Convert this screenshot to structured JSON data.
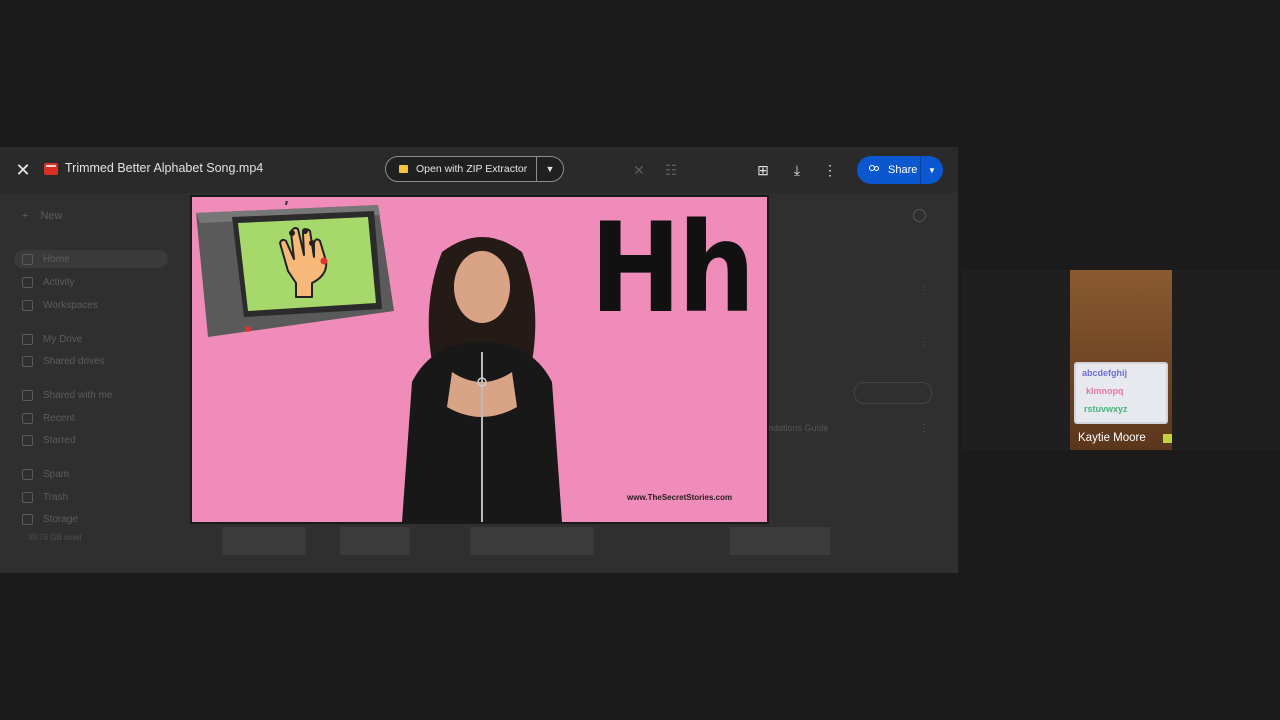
{
  "viewer": {
    "file_title": "Trimmed Better Alphabet Song.mp4",
    "open_with_label": "Open with ZIP Extractor",
    "share_label": "Share"
  },
  "drive_background": {
    "new_label": "New",
    "nav": [
      {
        "label": "Home",
        "icon": "home-icon"
      },
      {
        "label": "Activity",
        "icon": "activity-icon"
      },
      {
        "label": "Workspaces",
        "icon": "workspaces-icon"
      },
      {
        "label": "My Drive",
        "icon": "drive-icon"
      },
      {
        "label": "Shared drives",
        "icon": "shared-drives-icon"
      },
      {
        "label": "Shared with me",
        "icon": "people-icon"
      },
      {
        "label": "Recent",
        "icon": "clock-icon"
      },
      {
        "label": "Starred",
        "icon": "star-icon"
      },
      {
        "label": "Spam",
        "icon": "spam-icon"
      },
      {
        "label": "Trash",
        "icon": "trash-icon"
      },
      {
        "label": "Storage",
        "icon": "cloud-icon"
      }
    ],
    "storage_text": "30.76 GB used",
    "right_item_text": "ndations Guide"
  },
  "video": {
    "letters": "Hh",
    "watermark": "www.TheSecretStories.com"
  },
  "participant": {
    "name": "Kaytie Moore",
    "board_rows": [
      "abcdefghij",
      "klmnopq",
      "rstuvwxyz"
    ]
  },
  "colors": {
    "share_blue": "#0b57d0",
    "video_pink": "#f08cb9",
    "zip_yellow": "#f2c53d"
  }
}
